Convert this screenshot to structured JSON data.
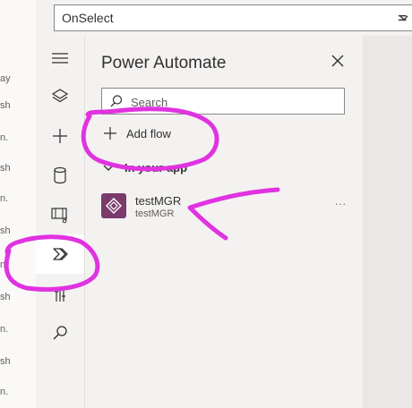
{
  "formula_bar": {
    "property_value": "OnSelect",
    "equals": "="
  },
  "left_strip_fragments": [
    "ay",
    "sh",
    "n.",
    "sh",
    "n.",
    "sh",
    "n.",
    "sh",
    "n.",
    "sh",
    "n.",
    "sh"
  ],
  "rail": {
    "items": [
      {
        "icon": "hamburger-icon"
      },
      {
        "icon": "layers-icon"
      },
      {
        "icon": "plus-icon"
      },
      {
        "icon": "database-icon"
      },
      {
        "icon": "media-icon"
      },
      {
        "icon": "power-automate-icon",
        "active": true
      },
      {
        "icon": "variables-icon"
      },
      {
        "icon": "search-icon"
      }
    ]
  },
  "panel": {
    "title": "Power Automate",
    "search_placeholder": "Search",
    "add_flow_label": "Add flow",
    "section_label": "In your app",
    "flows": [
      {
        "name": "testMGR",
        "subtitle": "testMGR",
        "more": "..."
      }
    ]
  },
  "colors": {
    "annotation": "#e033e0",
    "flow_logo": "#7a3a6b"
  }
}
